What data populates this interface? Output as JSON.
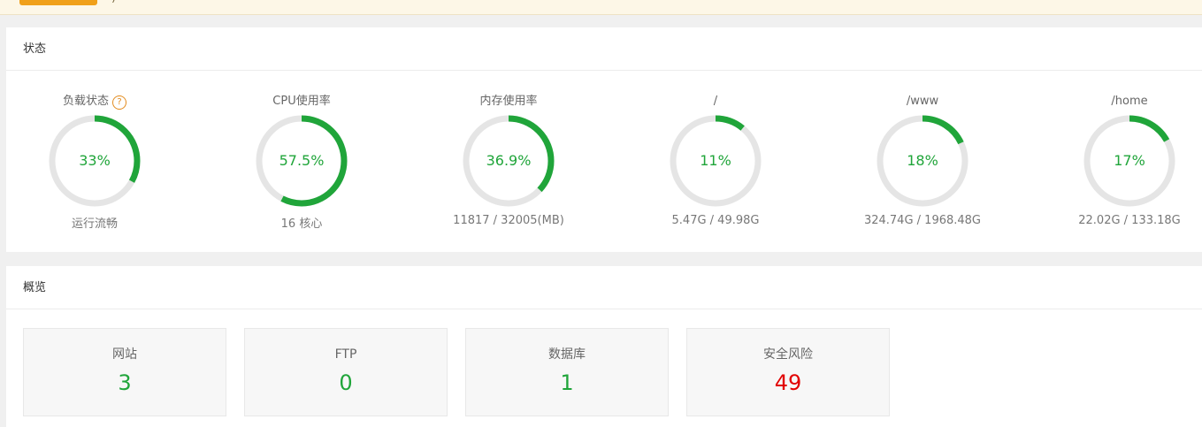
{
  "colors": {
    "accent": "#20a53a",
    "ring_track": "#e5e5e5",
    "danger": "#e20000",
    "banner_bg": "#fdf7e7",
    "banner_button": "#f0a01a"
  },
  "banner": {
    "text": ")"
  },
  "status": {
    "title": "状态",
    "gauges": [
      {
        "title": "负载状态",
        "percent_text": "33%",
        "value": 33,
        "sub": "运行流畅",
        "help": "?"
      },
      {
        "title": "CPU使用率",
        "percent_text": "57.5%",
        "value": 57.5,
        "sub": "16 核心"
      },
      {
        "title": "内存使用率",
        "percent_text": "36.9%",
        "value": 36.9,
        "sub": "11817 / 32005(MB)"
      },
      {
        "title": "/",
        "percent_text": "11%",
        "value": 11,
        "sub": "5.47G / 49.98G"
      },
      {
        "title": "/www",
        "percent_text": "18%",
        "value": 18,
        "sub": "324.74G / 1968.48G"
      },
      {
        "title": "/home",
        "percent_text": "17%",
        "value": 17,
        "sub": "22.02G / 133.18G"
      }
    ]
  },
  "overview": {
    "title": "概览",
    "cards": [
      {
        "label": "网站",
        "value": "3"
      },
      {
        "label": "FTP",
        "value": "0"
      },
      {
        "label": "数据库",
        "value": "1"
      },
      {
        "label": "安全风险",
        "value": "49",
        "status": "danger"
      }
    ]
  }
}
